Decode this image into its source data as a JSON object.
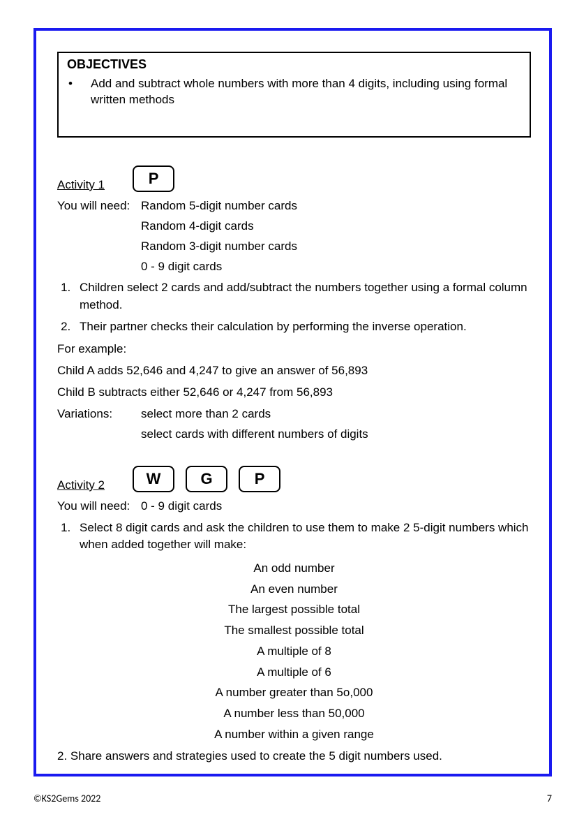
{
  "objectives": {
    "title": "OBJECTIVES",
    "bullet": "•",
    "text": "Add and subtract whole numbers with more than 4 digits, including using formal written methods"
  },
  "activity1": {
    "label": "Activity 1",
    "tags": [
      "P"
    ],
    "need_label": "You will need:",
    "needs": [
      "Random 5-digit number cards",
      "Random 4-digit cards",
      "Random 3-digit number cards",
      "0 - 9 digit cards"
    ],
    "steps": [
      "Children select 2 cards and add/subtract the numbers together using a formal column method.",
      "Their partner checks their calculation by performing the inverse operation."
    ],
    "example_label": "For example:",
    "example_lines": [
      "Child A adds 52,646 and 4,247 to give an answer of 56,893",
      "Child B subtracts either 52,646 or 4,247 from 56,893"
    ],
    "variations_label": "Variations:",
    "variations": [
      "select more than 2 cards",
      "select cards with different numbers of digits"
    ]
  },
  "activity2": {
    "label": "Activity 2",
    "tags": [
      "W",
      "G",
      "P"
    ],
    "need_label": "You will need:",
    "needs": [
      "0 - 9 digit cards"
    ],
    "step1": "Select 8 digit cards and ask the children to use them to make 2 5-digit numbers which when added together will make:",
    "targets": [
      "An odd number",
      "An even number",
      "The largest possible total",
      "The smallest possible total",
      "A multiple of 8",
      "A multiple of 6",
      "A number greater than 5o,000",
      "A number less than 50,000",
      "A number within a given range"
    ],
    "step2": "2. Share answers and strategies used to create the 5 digit numbers used."
  },
  "footer": {
    "copyright": "©KS2Gems 2022",
    "page": "7"
  }
}
